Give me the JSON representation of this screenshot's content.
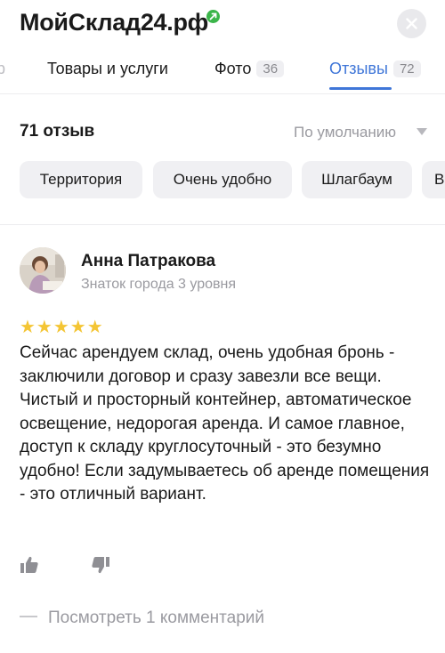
{
  "header": {
    "title": "МойСклад24.рф"
  },
  "tabs": [
    {
      "label": "р",
      "count": ""
    },
    {
      "label": "Товары и услуги",
      "count": ""
    },
    {
      "label": "Фото",
      "count": "36"
    },
    {
      "label": "Отзывы",
      "count": "72"
    }
  ],
  "colors": {
    "accent": "#3f76d8",
    "star": "#f4c534",
    "verified": "#3bb54a"
  },
  "reviews_summary": {
    "count_label": "71 отзыв",
    "sort_label": "По умолчанию"
  },
  "chips": [
    "Территория",
    "Очень удобно",
    "Шлагбаум",
    "В"
  ],
  "review": {
    "author": "Анна Патракова",
    "level": "Знаток города 3 уровня",
    "rating": 5,
    "stars": "★★★★★",
    "text": "Сейчас арендуем склад, очень удобная бронь - заключили договор и сразу завезли все вещи. Чистый и просторный контейнер, автоматическое освещение, недорогая аренда. И самое главное, доступ к складу круглосуточный - это безумно удобно! Если задумываетесь об аренде помещения - это отличный вариант.",
    "comments_label": "Посмотреть 1 комментарий"
  }
}
